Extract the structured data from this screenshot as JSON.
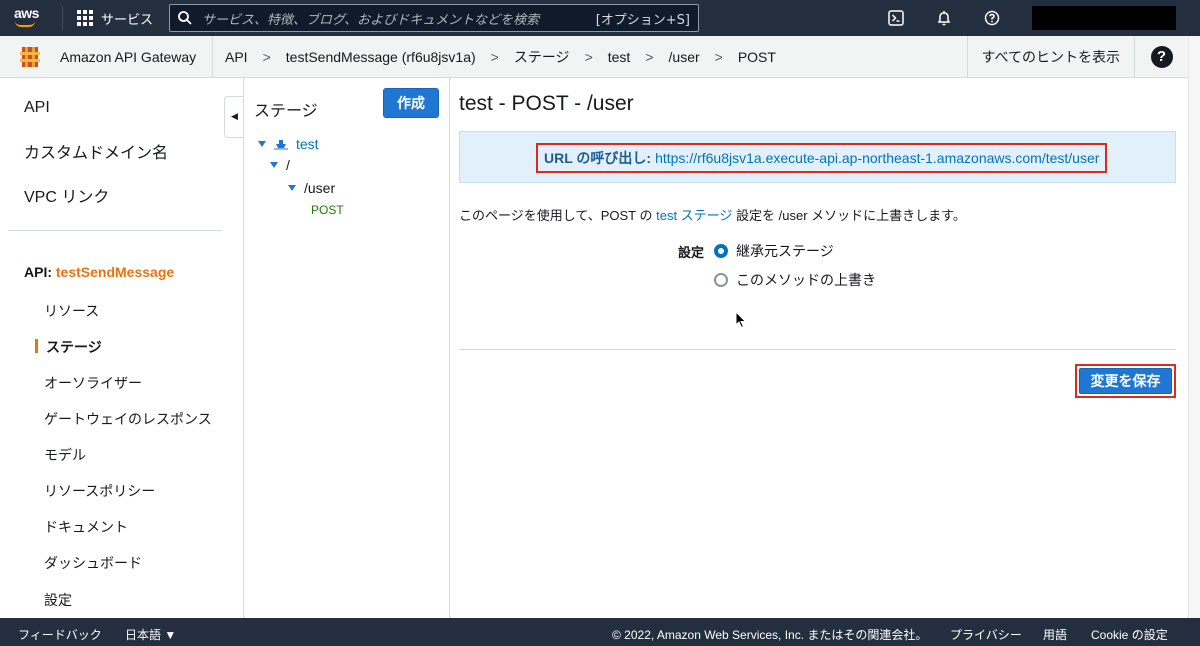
{
  "topnav": {
    "logo_text": "aws",
    "services_label": "サービス",
    "search_placeholder": "サービス、特徴、ブログ、およびドキュメントなどを検索",
    "search_shortcut": "[オプション+S]"
  },
  "breadcrumb_bar": {
    "service_name": "Amazon API Gateway",
    "crumbs": [
      "API",
      "testSendMessage (rf6u8jsv1a)",
      "ステージ",
      "test",
      "/user",
      "POST"
    ],
    "separator": ">",
    "hints_label": "すべてのヒントを表示",
    "help_label": "?"
  },
  "sidebar": {
    "top_items": [
      "API",
      "カスタムドメイン名",
      "VPC リンク"
    ],
    "api_prefix": "API: ",
    "api_name": "testSendMessage",
    "items": [
      "リソース",
      "ステージ",
      "オーソライザー",
      "ゲートウェイのレスポンス",
      "モデル",
      "リソースポリシー",
      "ドキュメント",
      "ダッシュボード",
      "設定"
    ],
    "active_item": "ステージ"
  },
  "tree": {
    "title": "ステージ",
    "create_label": "作成",
    "stage": "test",
    "root": "/",
    "resource": "/user",
    "method": "POST"
  },
  "main": {
    "title": "test - POST - /user",
    "invoke_url_label": "URL の呼び出し:",
    "invoke_url": "https://rf6u8jsv1a.execute-api.ap-northeast-1.amazonaws.com/test/user",
    "desc_prefix": "このページを使用して、POST の",
    "desc_link": "test ステージ",
    "desc_suffix": "設定を /user メソッドに上書きします。",
    "setting_label": "設定",
    "option_inherit": "継承元ステージ",
    "option_override": "このメソッドの上書き",
    "selected_option": "継承元ステージ",
    "save_label": "変更を保存"
  },
  "footer": {
    "feedback": "フィードバック",
    "language": "日本語 ▼",
    "copyright": "© 2022, Amazon Web Services, Inc. またはその関連会社。",
    "privacy": "プライバシー",
    "terms": "用語",
    "cookie": "Cookie の設定"
  },
  "colors": {
    "nav_bg": "#232f3e",
    "accent_orange": "#ec7211",
    "primary_blue": "#1f77d3",
    "link_blue": "#0073bb",
    "highlight_red": "#dd2a1b"
  }
}
